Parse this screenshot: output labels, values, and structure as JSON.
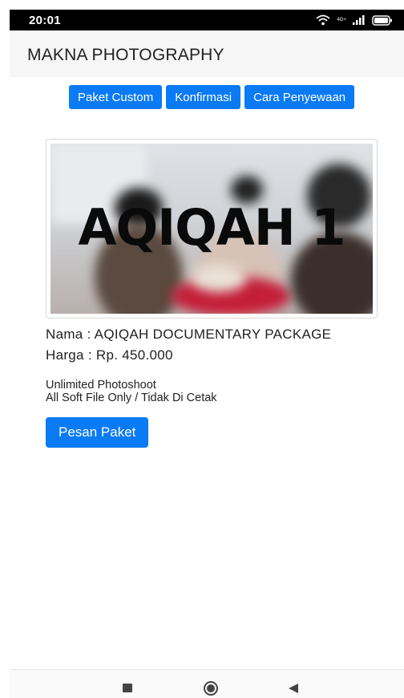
{
  "status_bar": {
    "time": "20:01",
    "network_label": "4G+",
    "icons": [
      "wifi-icon",
      "signal-icon",
      "battery-icon"
    ]
  },
  "app_bar": {
    "title": "MAKNA PHOTOGRAPHY"
  },
  "nav_buttons": [
    {
      "label": "Paket Custom"
    },
    {
      "label": "Konfirmasi"
    },
    {
      "label": "Cara Penyewaan"
    }
  ],
  "package": {
    "image_text": "AQIQAH 1",
    "name_line": "Nama : AQIQAH DOCUMENTARY PACKAGE",
    "price_line": "Harga : Rp. 450.000",
    "description": [
      "Unlimited Photoshoot",
      "All Soft File Only / Tidak Di Cetak"
    ],
    "order_button": "Pesan Paket"
  },
  "system_nav": {
    "icons": [
      "recents-icon",
      "home-icon",
      "back-icon"
    ]
  },
  "colors": {
    "accent": "#0a7af5",
    "status_bar": "#000000",
    "app_bar": "#f6f6f6"
  }
}
